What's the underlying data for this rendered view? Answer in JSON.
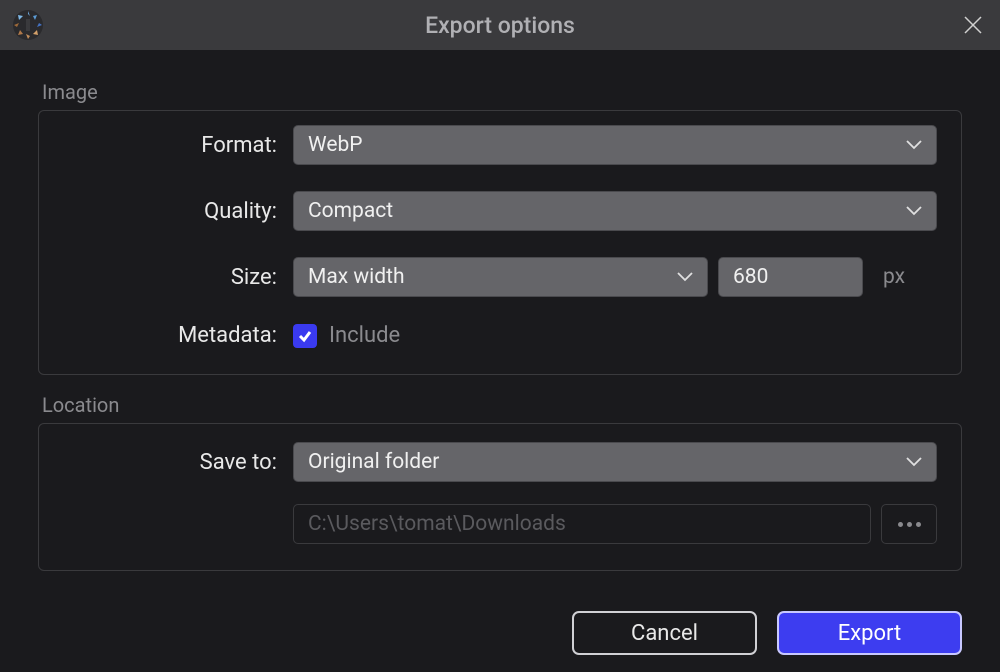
{
  "window": {
    "title": "Export options"
  },
  "groups": {
    "image": {
      "label": "Image",
      "format_label": "Format:",
      "format_value": "WebP",
      "quality_label": "Quality:",
      "quality_value": "Compact",
      "size_label": "Size:",
      "size_mode": "Max width",
      "size_value": "680",
      "size_unit": "px",
      "metadata_label": "Metadata:",
      "metadata_include": "Include",
      "metadata_checked": true
    },
    "location": {
      "label": "Location",
      "saveto_label": "Save to:",
      "saveto_value": "Original folder",
      "path_value": "C:\\Users\\tomat\\Downloads"
    }
  },
  "buttons": {
    "cancel": "Cancel",
    "export": "Export"
  }
}
